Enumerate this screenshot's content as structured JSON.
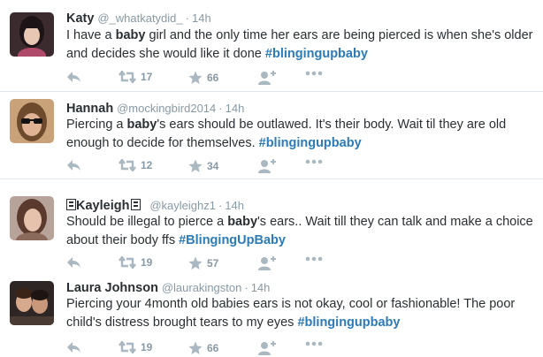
{
  "tweets": [
    {
      "name": "Katy",
      "handle": "@_whatkatydid_",
      "time": "14h",
      "text_parts": [
        "I have a ",
        "baby",
        " girl and the only time her ears are being pierced is when she's older and decides she would like it done "
      ],
      "hashtag": "#blingingupbaby",
      "retweets": "17",
      "favorites": "66",
      "avatar_color": "#3b2a2e"
    },
    {
      "name": "Hannah",
      "handle": "@mockingbird2014",
      "time": "14h",
      "text_parts": [
        "Piercing a ",
        "baby",
        "'s ears should be outlawed. It's their body. Wait til they are old enough to decide for themselves. "
      ],
      "hashtag": "#blingingupbaby",
      "retweets": "12",
      "favorites": "34",
      "avatar_color": "#6d4a2c"
    },
    {
      "name": "Kayleigh",
      "handle": "@kayleighz1",
      "time": "14h",
      "text_parts": [
        "Should be illegal to pierce a ",
        "baby",
        "'s ears.. Wait till they can talk and make a choice about their body ffs "
      ],
      "hashtag": "#BlingingUpBaby",
      "retweets": "19",
      "favorites": "57",
      "avatar_color": "#8a6a5a"
    },
    {
      "name": "Laura Johnson",
      "handle": "@laurakingston",
      "time": "14h",
      "text_parts": [
        "Piercing your 4month old babies ears is not okay, cool or fashionable! The poor child's distress brought tears to my eyes "
      ],
      "hashtag": "#blingingupbaby",
      "retweets": "19",
      "favorites": "66",
      "avatar_color": "#2e2624"
    }
  ],
  "dot": "·",
  "colors": {
    "hashtag": "#2b7bb9",
    "meta": "#8899a6",
    "icon": "#aab8c2",
    "divider": "#e1e8ed"
  }
}
